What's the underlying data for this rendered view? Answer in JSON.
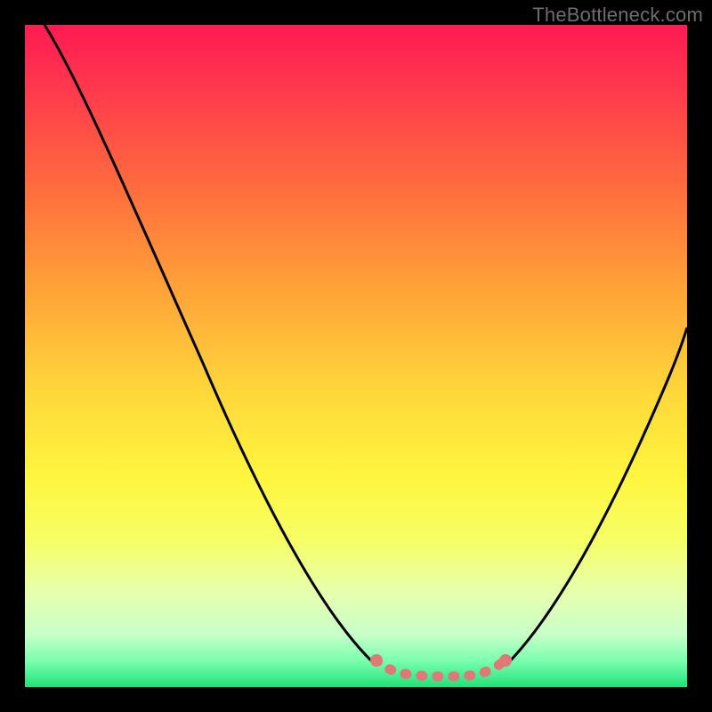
{
  "watermark": "TheBottleneck.com",
  "chart_data": {
    "type": "line",
    "title": "",
    "xlabel": "",
    "ylabel": "",
    "xlim": [
      0,
      100
    ],
    "ylim": [
      0,
      100
    ],
    "grid": false,
    "background_gradient": {
      "top": "#ff1a53",
      "mid": "#ffd63a",
      "bottom": "#22e07a"
    },
    "series": [
      {
        "name": "curve-left",
        "stroke": "#000000",
        "x": [
          3,
          8,
          14,
          20,
          26,
          32,
          38,
          44,
          48,
          51,
          53
        ],
        "values": [
          100,
          92,
          82,
          70,
          57,
          44,
          31,
          18,
          9,
          4,
          2
        ]
      },
      {
        "name": "curve-right",
        "stroke": "#000000",
        "x": [
          72,
          76,
          80,
          84,
          88,
          92,
          96,
          100
        ],
        "values": [
          2,
          6,
          12,
          19,
          27,
          36,
          45,
          55
        ]
      },
      {
        "name": "floor-dots",
        "stroke": "#e07878",
        "marker": "circle",
        "x": [
          52,
          54,
          56,
          58,
          60,
          62,
          64,
          66,
          68,
          70,
          72
        ],
        "values": [
          2,
          1,
          1,
          1,
          1,
          1,
          1,
          1,
          1,
          2,
          3
        ]
      }
    ],
    "annotations": []
  }
}
